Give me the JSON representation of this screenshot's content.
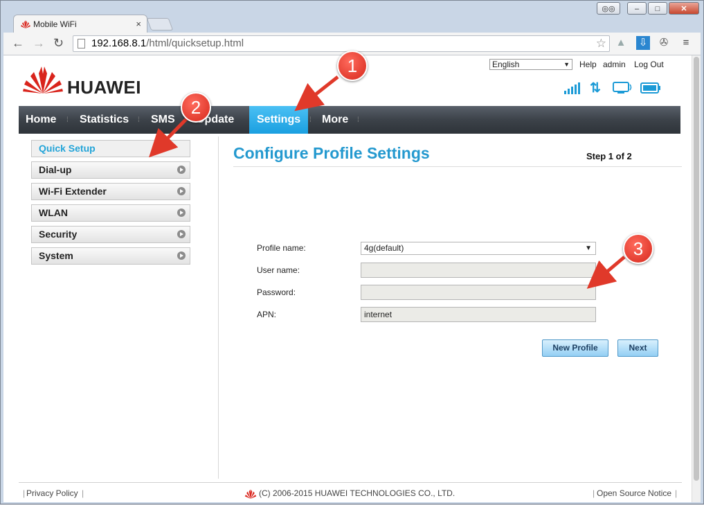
{
  "browser": {
    "tab_title": "Mobile WiFi",
    "tab_close": "×",
    "url_host": "192.168.8.1",
    "url_path": "/html/quicksetup.html",
    "window_buttons": {
      "minimize": "–",
      "maximize": "□",
      "close": "✕"
    }
  },
  "header": {
    "brand_name": "HUAWEI",
    "language": "English",
    "links": {
      "help": "Help",
      "user": "admin",
      "logout": "Log Out"
    }
  },
  "nav": {
    "items": [
      {
        "label": "Home",
        "active": false
      },
      {
        "label": "Statistics",
        "active": false
      },
      {
        "label": "SMS",
        "active": false
      },
      {
        "label": "Update",
        "active": false
      },
      {
        "label": "Settings",
        "active": true
      },
      {
        "label": "More",
        "active": false
      }
    ]
  },
  "sidebar": {
    "items": [
      {
        "label": "Quick Setup",
        "active": true
      },
      {
        "label": "Dial-up",
        "active": false
      },
      {
        "label": "Wi-Fi Extender",
        "active": false
      },
      {
        "label": "WLAN",
        "active": false
      },
      {
        "label": "Security",
        "active": false
      },
      {
        "label": "System",
        "active": false
      }
    ]
  },
  "main": {
    "title": "Configure Profile Settings",
    "step": "Step 1 of 2",
    "form": {
      "profile_label": "Profile name:",
      "profile_value": "4g(default)",
      "username_label": "User name:",
      "username_value": "",
      "password_label": "Password:",
      "password_value": "",
      "apn_label": "APN:",
      "apn_value": "internet"
    },
    "buttons": {
      "new_profile": "New Profile",
      "next": "Next"
    }
  },
  "footer": {
    "privacy": "Privacy Policy",
    "copyright": "(C) 2006-2015 HUAWEI TECHNOLOGIES CO., LTD.",
    "open_source": "Open Source Notice"
  },
  "annotations": {
    "one": "1",
    "two": "2",
    "three": "3"
  },
  "colors": {
    "accent": "#2499cf",
    "annotation": "#e0392a",
    "brand_red": "#d9241c"
  }
}
